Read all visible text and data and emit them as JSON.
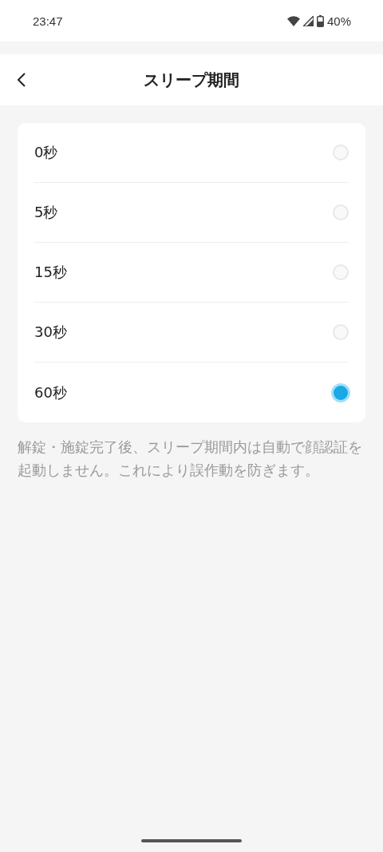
{
  "status_bar": {
    "time": "23:47",
    "battery": "40%"
  },
  "header": {
    "title": "スリープ期間"
  },
  "options": [
    {
      "label": "0秒",
      "selected": false
    },
    {
      "label": "5秒",
      "selected": false
    },
    {
      "label": "15秒",
      "selected": false
    },
    {
      "label": "30秒",
      "selected": false
    },
    {
      "label": "60秒",
      "selected": true
    }
  ],
  "description": "解錠・施錠完了後、スリープ期間内は自動で顔認証を起動しません。これにより誤作動を防ぎます。"
}
